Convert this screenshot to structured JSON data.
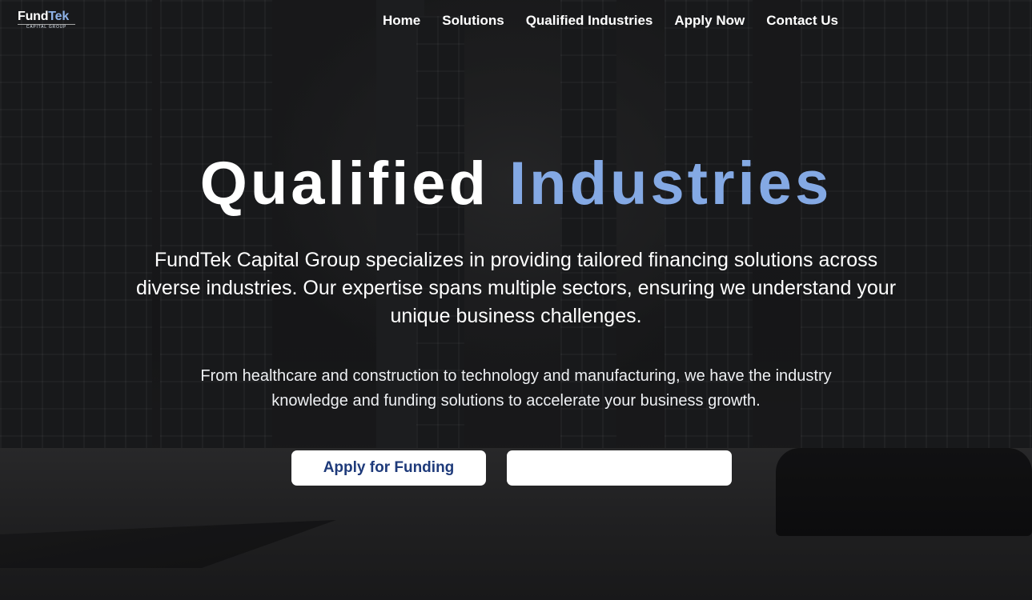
{
  "logo": {
    "brand_part1": "Fund",
    "brand_part2": "Tek",
    "tagline": "CAPITAL GROUP"
  },
  "nav": {
    "items": [
      {
        "label": "Home"
      },
      {
        "label": "Solutions"
      },
      {
        "label": "Qualified Industries"
      },
      {
        "label": "Apply Now"
      },
      {
        "label": "Contact Us"
      }
    ]
  },
  "hero": {
    "title_plain": "Qualified",
    "title_accent": "Industries",
    "lead": "FundTek Capital Group specializes in providing tailored financing solutions across diverse industries. Our expertise spans multiple sectors, ensuring we understand your unique business challenges.",
    "sub": "From healthcare and construction to technology and manufacturing, we have the industry knowledge and funding solutions to accelerate your business growth.",
    "primary_button": "Apply for Funding",
    "secondary_button": ""
  },
  "colors": {
    "accent": "#84a9e4",
    "button_text": "#1e3a7a",
    "button_bg": "#ffffff"
  }
}
